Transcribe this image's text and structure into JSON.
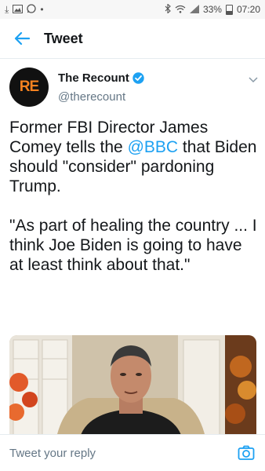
{
  "status_bar": {
    "battery": "33%",
    "time": "07:20"
  },
  "header": {
    "title": "Tweet",
    "back_icon": "arrow-left-icon"
  },
  "author": {
    "avatar_text": "RE",
    "name": "The Recount",
    "handle": "@therecount",
    "verified": true
  },
  "tweet": {
    "text_part1": "Former FBI Director James Comey tells the ",
    "mention": "@BBC",
    "text_part2": " that Biden should \"consider\" pardoning Trump.\n\n\"As part of healing the country ... I think Joe Biden is going to have at least think about that.\""
  },
  "reply": {
    "placeholder": "Tweet your reply",
    "camera_icon": "camera-icon"
  },
  "colors": {
    "accent": "#1da1f2",
    "secondary_text": "#657786",
    "avatar_text": "#f58220"
  }
}
